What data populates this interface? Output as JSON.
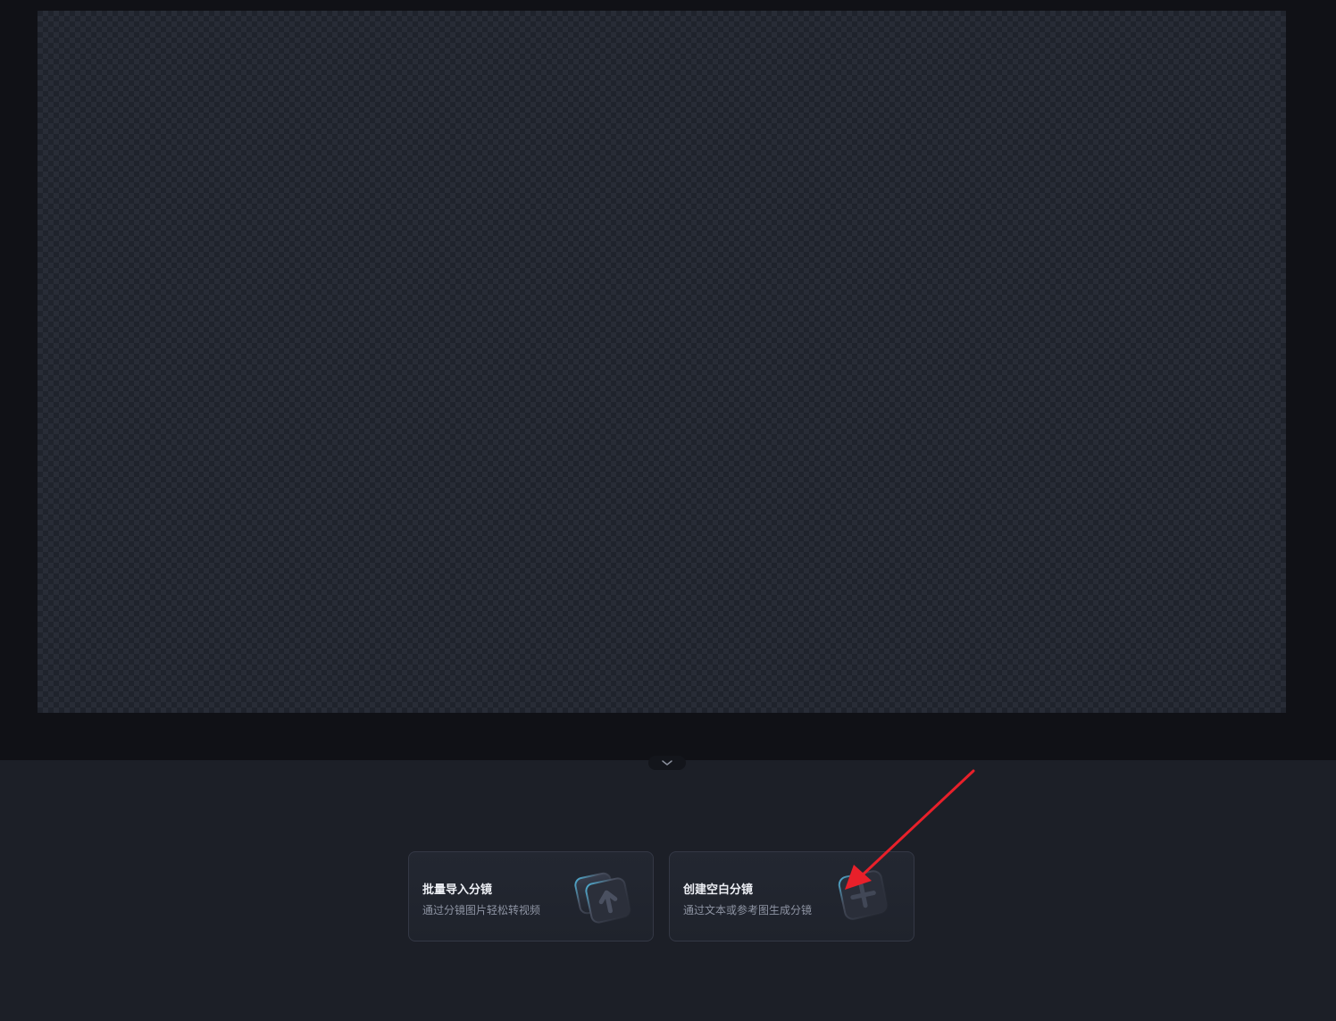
{
  "storyboard": {
    "collapse_icon": "chevron-down-icon"
  },
  "cards": {
    "import": {
      "title": "批量导入分镜",
      "description": "通过分镜图片轻松转视频",
      "icon": "upload-stack-icon"
    },
    "create": {
      "title": "创建空白分镜",
      "description": "通过文本或参考图生成分镜",
      "icon": "add-frame-icon"
    }
  },
  "annotation": {
    "arrow_color": "#e8202a"
  }
}
